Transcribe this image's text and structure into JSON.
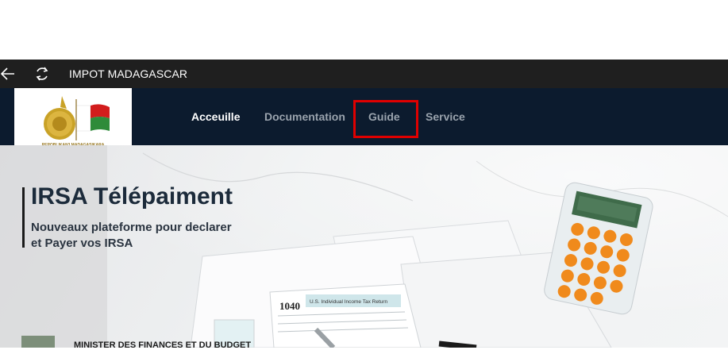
{
  "titlebar": {
    "back_icon": "arrow-left-icon",
    "refresh_icon": "refresh-icon",
    "title": "IMPOT MADAGASCAR"
  },
  "logo": {
    "caption": "REPOBLIKAN'I MADAGASIKARA"
  },
  "nav": {
    "items": [
      {
        "label": "Acceuille",
        "active": true
      },
      {
        "label": "Documentation",
        "active": false
      },
      {
        "label": "Guide",
        "active": false
      },
      {
        "label": "Service",
        "active": false
      }
    ]
  },
  "colors": {
    "titlebar": "#1f1f1f",
    "navbar": "#0c1b2e",
    "nav_active": "#ffffff",
    "nav_inactive": "#9aa3ad",
    "highlight": "#e00000"
  },
  "hero": {
    "title": "IRSA Télépaiment",
    "subtitle_line1": "Nouveaux plateforme pour declarer",
    "subtitle_line2": "et Payer vos IRSA",
    "form_number": "1040",
    "form_title": "U.S. Individual Income Tax Return"
  },
  "footer": {
    "ministry": "MINISTER DES FINANCES ET DU BUDGET"
  }
}
